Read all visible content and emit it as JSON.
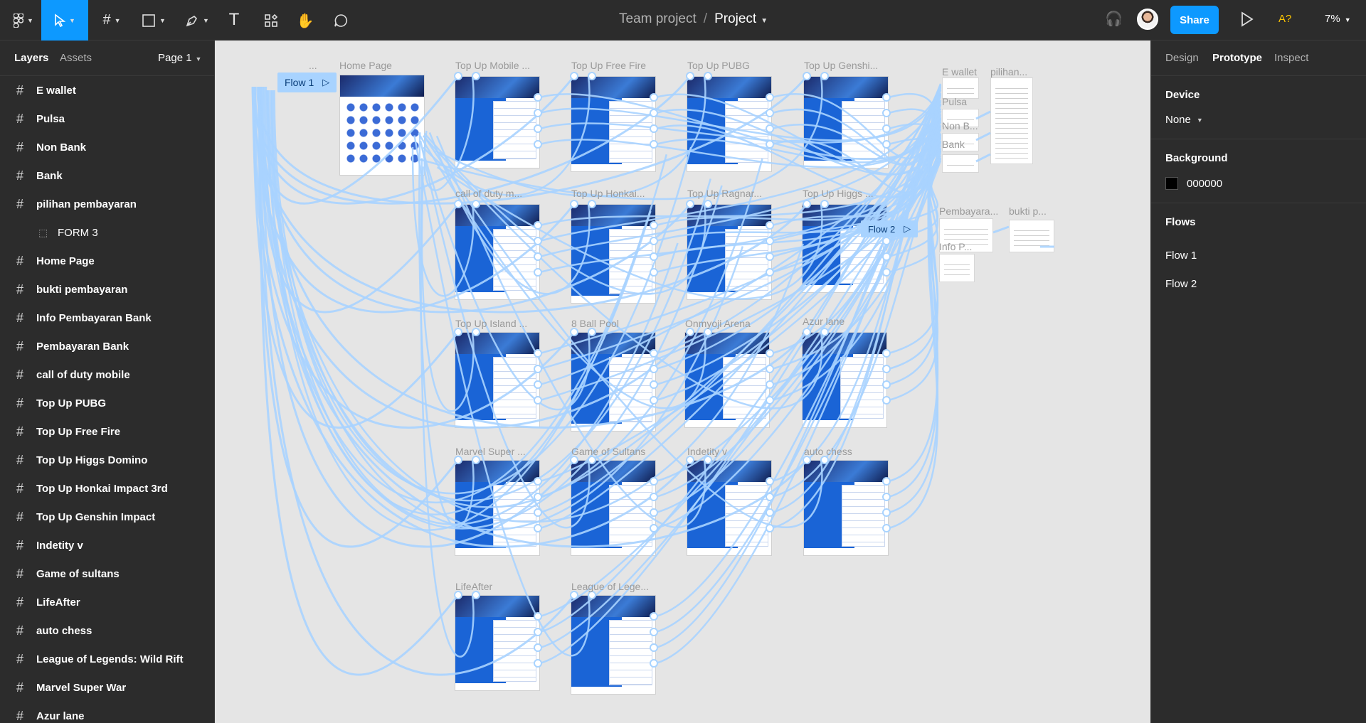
{
  "toolbar": {
    "team": "Team project",
    "separator": "/",
    "project": "Project",
    "share": "Share",
    "multiplayer_badge": "A?",
    "zoom": "7%",
    "icons": [
      "figma-menu-icon",
      "move-tool-icon",
      "frame-tool-icon",
      "shape-tool-icon",
      "pen-tool-icon",
      "text-tool-icon",
      "components-icon",
      "hand-tool-icon",
      "comment-icon",
      "headset-icon",
      "play-icon"
    ]
  },
  "left_panel": {
    "tab_layers": "Layers",
    "tab_assets": "Assets",
    "page": "Page 1",
    "layers": [
      {
        "name": "E wallet",
        "type": "frame"
      },
      {
        "name": "Pulsa",
        "type": "frame"
      },
      {
        "name": "Non Bank",
        "type": "frame"
      },
      {
        "name": "Bank",
        "type": "frame"
      },
      {
        "name": "pilihan pembayaran",
        "type": "frame"
      },
      {
        "name": "FORM 3",
        "type": "group"
      },
      {
        "name": "Home Page",
        "type": "frame"
      },
      {
        "name": "bukti pembayaran",
        "type": "frame"
      },
      {
        "name": "Info Pembayaran Bank",
        "type": "frame"
      },
      {
        "name": "Pembayaran Bank",
        "type": "frame"
      },
      {
        "name": "call of duty mobile",
        "type": "frame"
      },
      {
        "name": "Top Up PUBG",
        "type": "frame"
      },
      {
        "name": "Top Up Free Fire",
        "type": "frame"
      },
      {
        "name": "Top Up Higgs Domino",
        "type": "frame"
      },
      {
        "name": "Top Up Honkai Impact 3rd",
        "type": "frame"
      },
      {
        "name": "Top Up Genshin Impact",
        "type": "frame"
      },
      {
        "name": "Indetity v",
        "type": "frame"
      },
      {
        "name": "Game of sultans",
        "type": "frame"
      },
      {
        "name": "LifeAfter",
        "type": "frame"
      },
      {
        "name": "auto chess",
        "type": "frame"
      },
      {
        "name": "League of Legends: Wild Rift",
        "type": "frame"
      },
      {
        "name": "Marvel Super War",
        "type": "frame"
      },
      {
        "name": "Azur lane",
        "type": "frame"
      }
    ]
  },
  "canvas": {
    "flow1": "Flow 1",
    "flow2": "Flow 2",
    "frame_labels": {
      "dots": "...",
      "home": "Home Page",
      "ml": "Top Up Mobile ...",
      "ff": "Top Up Free Fire",
      "pubg": "Top Up PUBG",
      "genshin": "Top Up Genshi...",
      "ewallet": "E wallet",
      "pilihan": "pilihan...",
      "pulsa": "Pulsa",
      "nonbank": "Non B...",
      "bank": "Bank",
      "cod": "call of duty m...",
      "honkai": "Top Up Honkai...",
      "ragnarok": "Top Up Ragnar...",
      "higgs": "Top Up Higgs ...",
      "pembayaran": "Pembayara...",
      "bukti": "bukti p...",
      "info": "Info P...",
      "island": "Top Up Island ...",
      "pool": "8 Ball Pool",
      "onmyoji": "Onmyoji Arena",
      "azur": "Azur lane",
      "marvel": "Marvel Super ...",
      "sultans": "Game of Sultans",
      "identity": "Indetity v",
      "autochess": "auto chess",
      "lifeafter": "LifeAfter",
      "league": "League of Lege..."
    },
    "help": "?"
  },
  "right_panel": {
    "tab_design": "Design",
    "tab_prototype": "Prototype",
    "tab_inspect": "Inspect",
    "device_label": "Device",
    "device_value": "None",
    "background_label": "Background",
    "background_value": "000000",
    "background_color": "#000000",
    "flows_label": "Flows",
    "flows": [
      "Flow 1",
      "Flow 2"
    ]
  },
  "colors": {
    "accent": "#0d99ff",
    "connector": "#a8d3ff",
    "panel": "#2c2c2c",
    "canvas": "#e5e5e5"
  }
}
